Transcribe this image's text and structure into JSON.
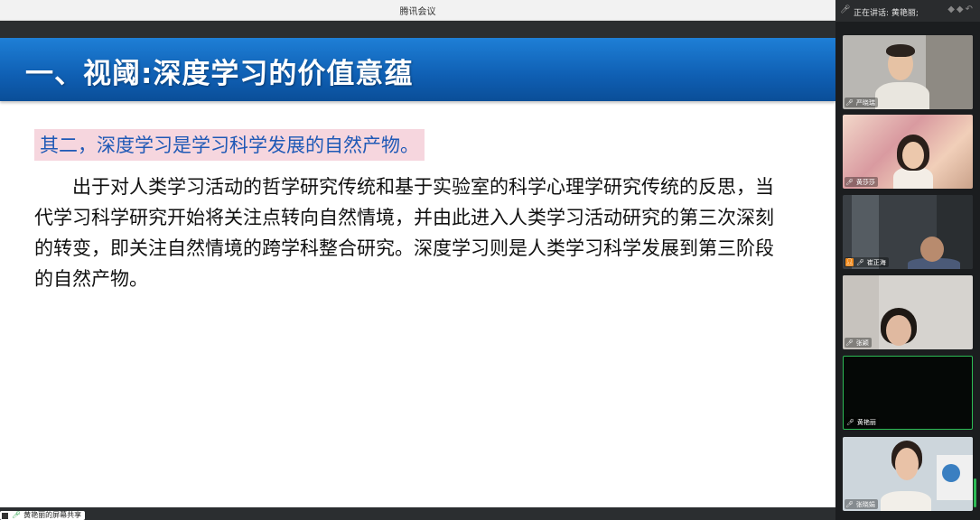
{
  "window": {
    "title": "腾讯会议"
  },
  "slide": {
    "heading": "一、视阈:深度学习的价值意蕴",
    "subheading": "其二，深度学习是学习科学发展的自然产物。",
    "paragraph": "出于对人类学习活动的哲学研究传统和基于实验室的科学心理学研究传统的反思，当代学习科学研究开始将关注点转向自然情境，并由此进入人类学习活动研究的第三次深刻的转变，即关注自然情境的跨学科整合研究。深度学习则是人类学习科学发展到第三阶段的自然产物。"
  },
  "share_indicator": {
    "label": "黄艳丽的屏幕共享"
  },
  "sidebar": {
    "speaking_label": "正在讲话: 黄艳丽;",
    "participants": [
      {
        "name": "严晓瑞",
        "icons": [
          "mic-icon"
        ],
        "bg": "#b9b7b3"
      },
      {
        "name": "黄莎莎",
        "icons": [
          "mic-icon"
        ],
        "bg": "#e8c4b8"
      },
      {
        "name": "崔正海",
        "icons": [
          "person-icon",
          "mic-icon"
        ],
        "bg": "#3a3f44"
      },
      {
        "name": "张颖",
        "icons": [
          "mic-icon"
        ],
        "bg": "#d6d3cf"
      },
      {
        "name": "黄艳丽",
        "icons": [
          "mic-icon"
        ],
        "bg": "#050806"
      },
      {
        "name": "张晓娟",
        "icons": [
          "mic-icon"
        ],
        "bg": "#cdd6dc"
      }
    ]
  },
  "colors": {
    "header_blue": "#0f5fb3",
    "subheading_text": "#1f59b6",
    "subheading_bg": "#f6d6de",
    "active_speaker_border": "#2dbb55"
  }
}
